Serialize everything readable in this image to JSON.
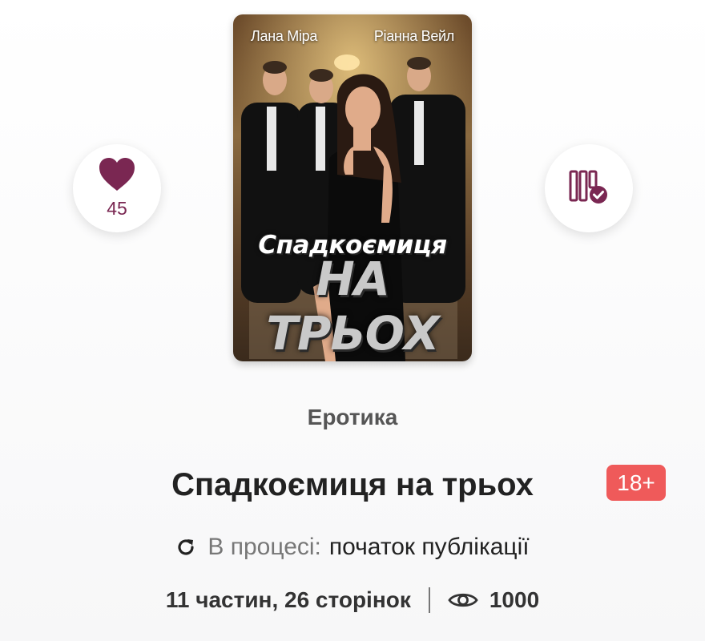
{
  "book": {
    "cover": {
      "author_left": "Лана Міра",
      "author_right": "Ріанна Вейл",
      "title_line1": "Спадкоємиця",
      "title_line2": "НА ТРЬОХ"
    },
    "genre": "Еротика",
    "title": "Спадкоємиця на трьох",
    "age_rating": "18+",
    "status_label": "В процесі:",
    "status_value": "початок публікації",
    "parts_pages": "11 частин, 26 сторінок",
    "views": "1000",
    "likes": "45"
  },
  "icons": {
    "like": "heart-icon",
    "library": "library-add-icon",
    "status": "refresh-icon",
    "views": "eye-icon"
  },
  "colors": {
    "accent": "#7a2752",
    "badge": "#ef5a5a"
  }
}
